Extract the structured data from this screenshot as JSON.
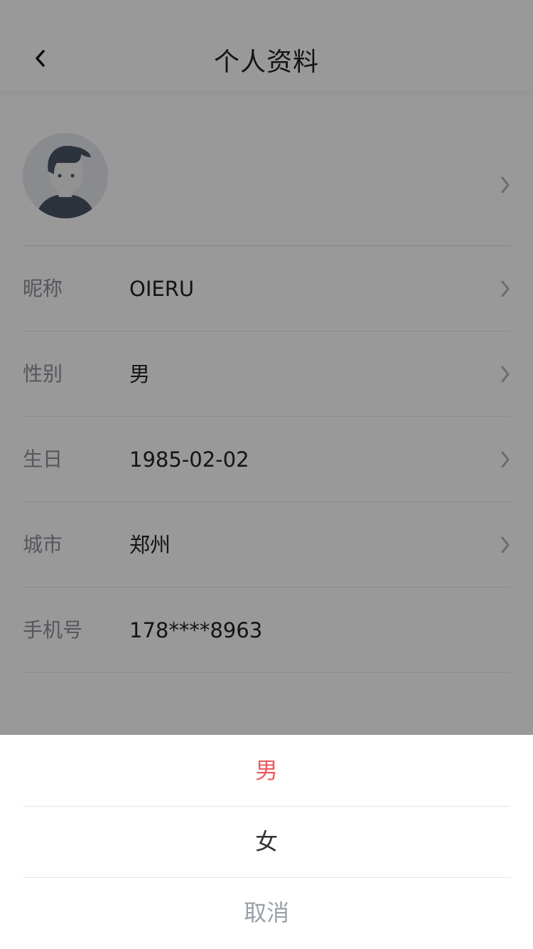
{
  "header": {
    "title": "个人资料"
  },
  "profile": {
    "rows": [
      {
        "label": "昵称",
        "value": "OIERU"
      },
      {
        "label": "性别",
        "value": "男"
      },
      {
        "label": "生日",
        "value": "1985-02-02"
      },
      {
        "label": "城市",
        "value": "郑州"
      },
      {
        "label": "手机号",
        "value": "178****8963"
      }
    ]
  },
  "action_sheet": {
    "options": [
      {
        "label": "男",
        "state": "selected"
      },
      {
        "label": "女",
        "state": "normal"
      }
    ],
    "cancel_label": "取消"
  },
  "colors": {
    "accent": "#ef5a5f",
    "overlay": "rgba(0,0,0,0.40)"
  },
  "icons": {
    "back": "chevron-left-icon",
    "row_arrow": "chevron-right-icon",
    "avatar": "default-avatar-icon"
  }
}
